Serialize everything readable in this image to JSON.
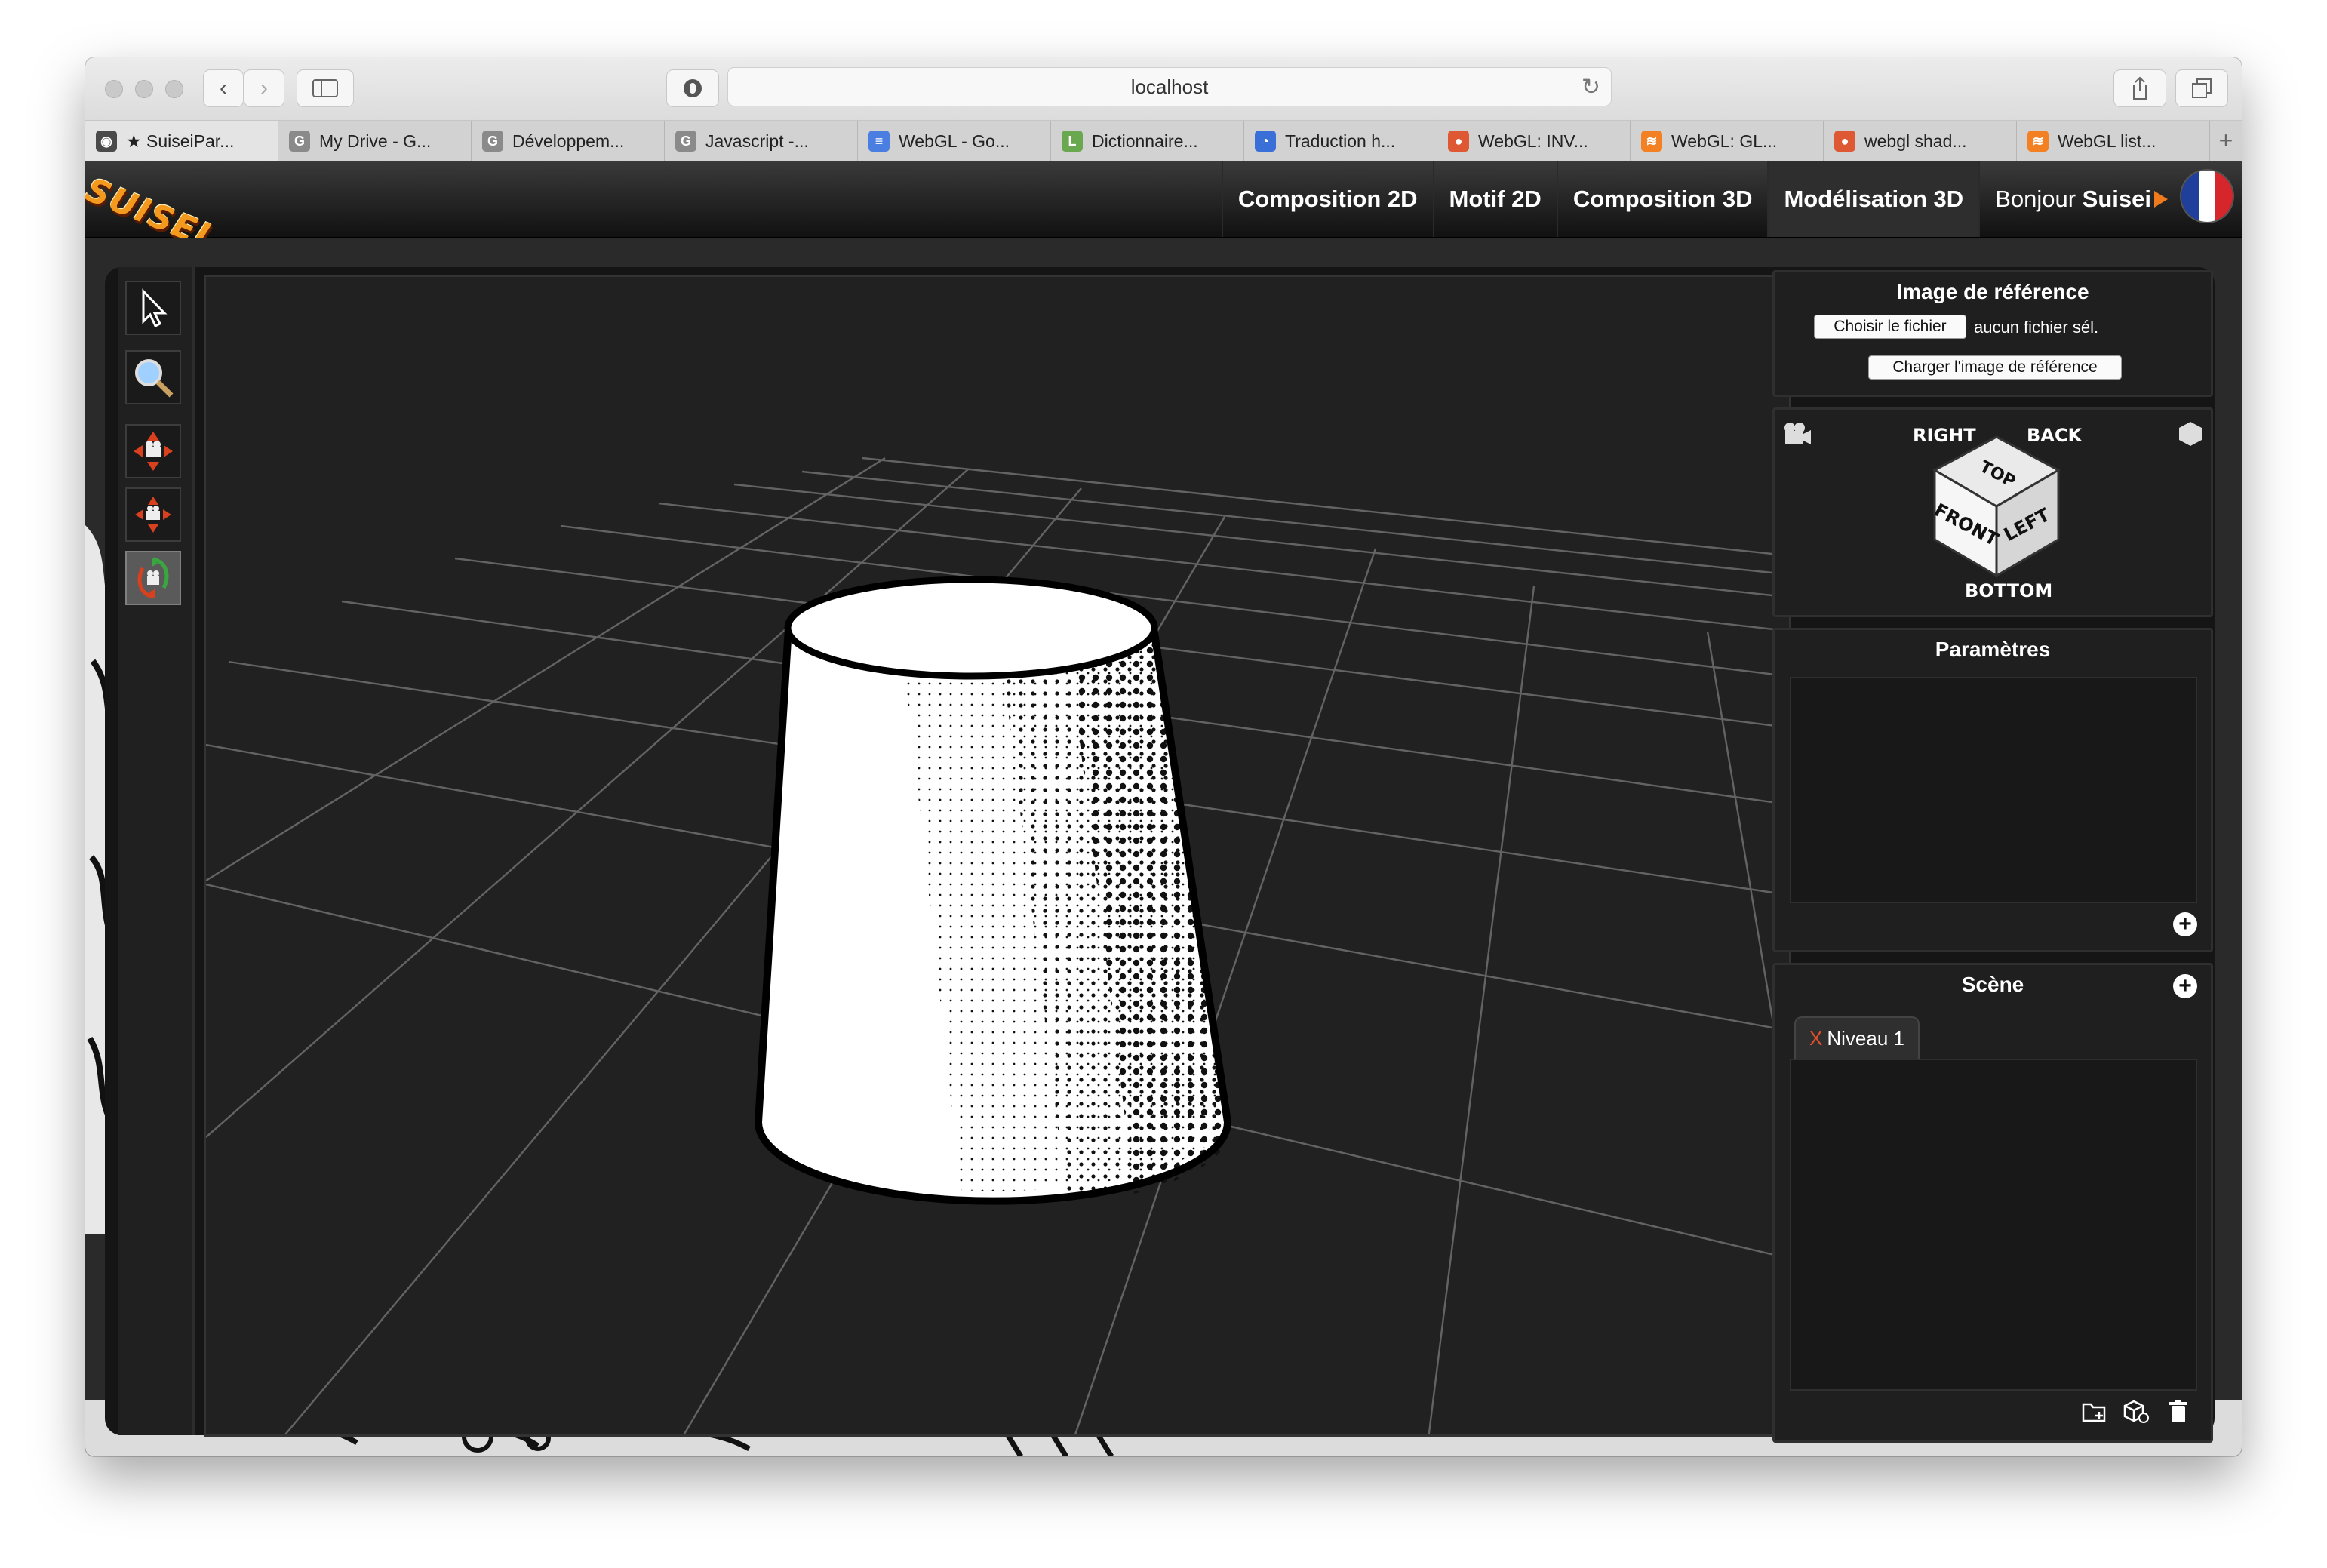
{
  "browser": {
    "url": "localhost",
    "tabs": [
      {
        "label": "★ SuiseiPar...",
        "icon": "github-favicon",
        "color": "#4a4a4a",
        "glyph": "◉"
      },
      {
        "label": "My Drive - G...",
        "icon": "google-favicon",
        "color": "#8a8a8a",
        "glyph": "G"
      },
      {
        "label": "Développem...",
        "icon": "google-favicon",
        "color": "#8a8a8a",
        "glyph": "G"
      },
      {
        "label": "Javascript -...",
        "icon": "google-favicon",
        "color": "#8a8a8a",
        "glyph": "G"
      },
      {
        "label": "WebGL - Go...",
        "icon": "docs-favicon",
        "color": "#4a7ee0",
        "glyph": "≡"
      },
      {
        "label": "Dictionnaire...",
        "icon": "dictionary-favicon",
        "color": "#6aa84f",
        "glyph": "L"
      },
      {
        "label": "Traduction h...",
        "icon": "translate-favicon",
        "color": "#3b6fd8",
        "glyph": "◔"
      },
      {
        "label": "WebGL: INV...",
        "icon": "duckduckgo-favicon",
        "color": "#de5833",
        "glyph": "●"
      },
      {
        "label": "WebGL: GL...",
        "icon": "stackoverflow-favicon",
        "color": "#f48024",
        "glyph": "≋"
      },
      {
        "label": "webgl shad...",
        "icon": "duckduckgo-favicon",
        "color": "#de5833",
        "glyph": "●"
      },
      {
        "label": "WebGL list...",
        "icon": "stackoverflow-favicon",
        "color": "#f48024",
        "glyph": "≋"
      }
    ]
  },
  "app": {
    "logo": "SUISEI",
    "nav": [
      {
        "label": "Composition 2D",
        "active": false
      },
      {
        "label": "Motif 2D",
        "active": false
      },
      {
        "label": "Composition 3D",
        "active": false
      },
      {
        "label": "Modélisation 3D",
        "active": true
      }
    ],
    "greeting": "Bonjour",
    "username": "Suisei",
    "flag_colors": [
      "#1f3f9a",
      "#ffffff",
      "#d6262c"
    ]
  },
  "tools": [
    {
      "name": "select-tool-icon"
    },
    {
      "name": "zoom-tool-icon"
    },
    {
      "name": "pan-camera-tool-icon"
    },
    {
      "name": "move-camera-tool-icon"
    },
    {
      "name": "orbit-camera-tool-icon",
      "selected": true
    }
  ],
  "reference": {
    "title": "Image de référence",
    "choose_label": "Choisir le fichier",
    "no_file": "aucun fichier sél.",
    "load_label": "Charger l'image de référence"
  },
  "viewcube": {
    "right": "RIGHT",
    "back": "BACK",
    "top": "TOP",
    "front": "FRONT",
    "left": "LEFT",
    "bottom": "BOTTOM"
  },
  "parameters": {
    "title": "Paramètres"
  },
  "scene": {
    "title": "Scène",
    "tab_close": "X",
    "tab_label": "Niveau 1"
  }
}
